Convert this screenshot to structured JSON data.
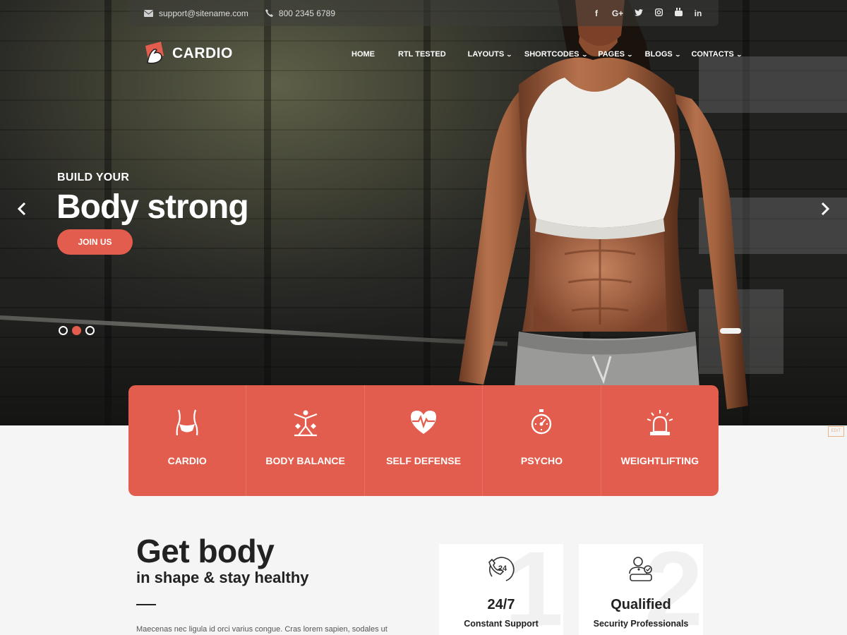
{
  "topbar": {
    "email": "support@sitename.com",
    "phone": "800 2345 6789",
    "socials": [
      "f",
      "G+",
      "t",
      "ig",
      "yt",
      "in"
    ]
  },
  "brand": {
    "name": "CARDIO"
  },
  "nav": {
    "items": [
      {
        "label": "HOME",
        "dropdown": false
      },
      {
        "label": "RTL TESTED",
        "dropdown": false
      },
      {
        "label": "LAYOUTS",
        "dropdown": true
      },
      {
        "label": "SHORTCODES",
        "dropdown": true
      },
      {
        "label": "PAGES",
        "dropdown": true
      },
      {
        "label": "BLOGS",
        "dropdown": true
      },
      {
        "label": "CONTACTS",
        "dropdown": true
      }
    ]
  },
  "hero": {
    "subtitle": "BUILD YOUR",
    "title": "Body strong",
    "cta": "JOIN US",
    "slides": 3,
    "active_slide": 2
  },
  "features": [
    {
      "label": "CARDIO",
      "icon": "waist-icon"
    },
    {
      "label": "BODY BALANCE",
      "icon": "balance-icon"
    },
    {
      "label": "SELF DEFENSE",
      "icon": "heartbeat-icon"
    },
    {
      "label": "PSYCHO",
      "icon": "stopwatch-icon"
    },
    {
      "label": "WEIGHTLIFTING",
      "icon": "alarm-light-icon"
    }
  ],
  "edit_label": "EDIT",
  "about": {
    "heading": "Get body",
    "subheading": "in shape & stay healthy",
    "paragraph": "Maecenas nec ligula id orci varius congue. Cras lorem sapien, sodales ut"
  },
  "cards": [
    {
      "number": "1",
      "title": "24/7",
      "subtitle": "Constant Support",
      "icon": "phone-24-icon"
    },
    {
      "number": "2",
      "title": "Qualified",
      "subtitle": "Security Professionals",
      "icon": "professional-icon"
    }
  ],
  "colors": {
    "accent": "#e35d4e",
    "dark": "#222222",
    "background": "#f5f5f5"
  }
}
